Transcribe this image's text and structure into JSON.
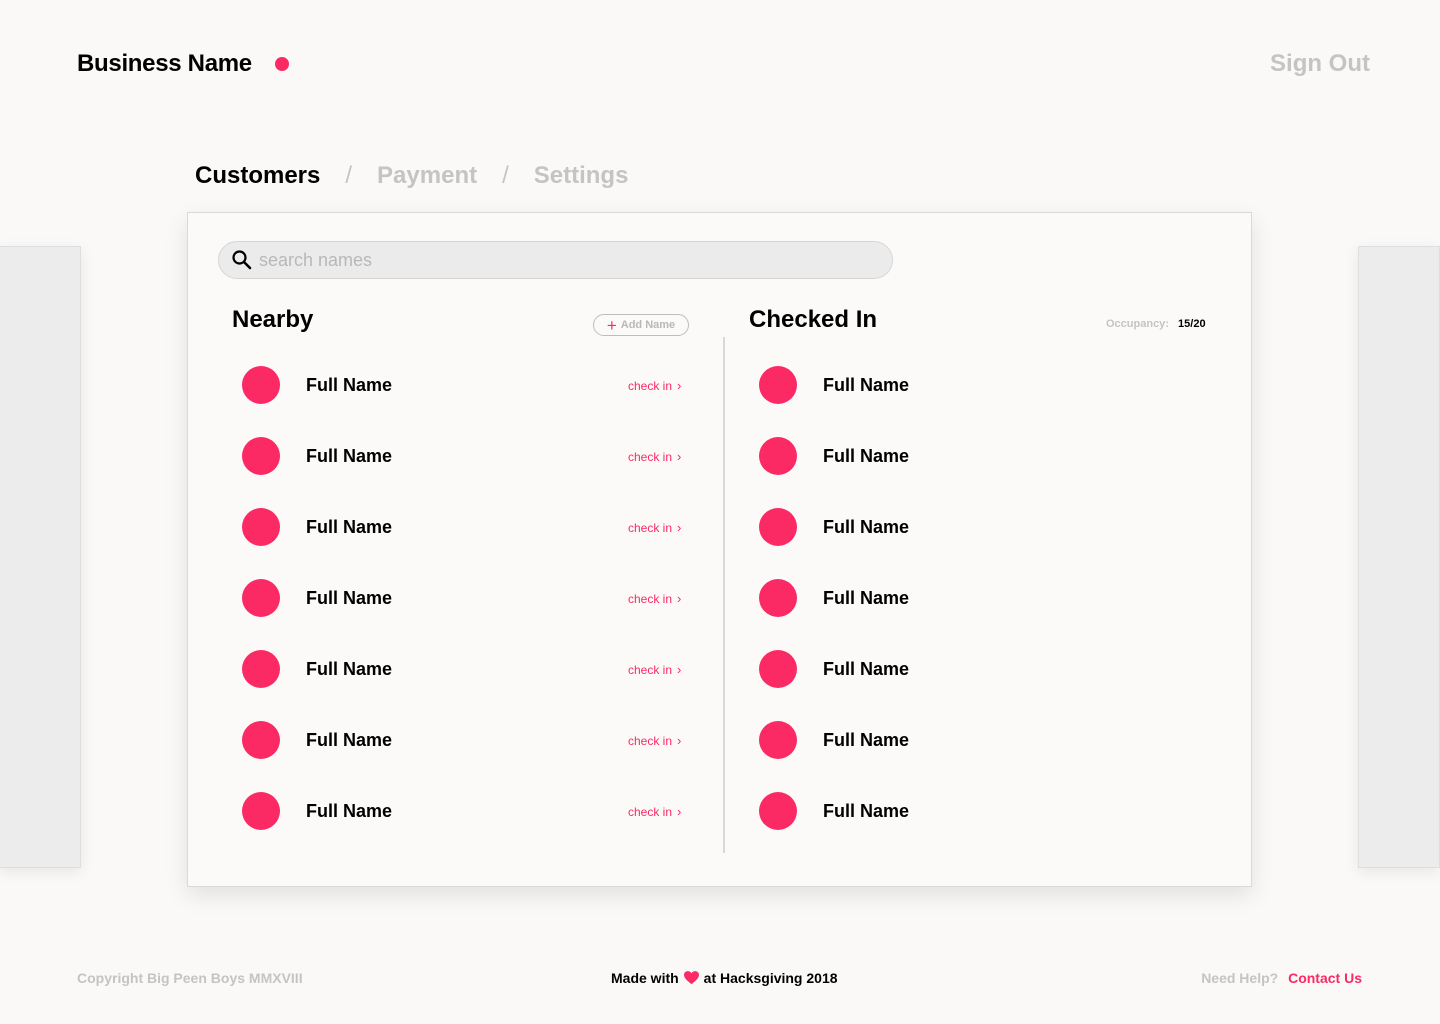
{
  "header": {
    "brand": "Business Name",
    "sign_out": "Sign Out"
  },
  "tabs": [
    {
      "label": "Customers",
      "active": true
    },
    {
      "label": "Payment",
      "active": false
    },
    {
      "label": "Settings",
      "active": false
    }
  ],
  "tab_separator": "/",
  "search": {
    "placeholder": "search names",
    "value": ""
  },
  "nearby": {
    "title": "Nearby",
    "add_name": "Add Name",
    "check_in_label": "check in",
    "items": [
      "Full Name",
      "Full Name",
      "Full Name",
      "Full Name",
      "Full Name",
      "Full Name",
      "Full Name"
    ]
  },
  "checked_in": {
    "title": "Checked In",
    "occupancy_label": "Occupancy:",
    "occupancy_value": "15/20",
    "items": [
      "Full Name",
      "Full Name",
      "Full Name",
      "Full Name",
      "Full Name",
      "Full Name",
      "Full Name"
    ]
  },
  "footer": {
    "copyright": "Copyright Big Peen Boys MMXVIII",
    "made_with": "Made with",
    "made_at": "at Hacksgiving 2018",
    "need_help": "Need Help?",
    "contact": "Contact Us"
  },
  "colors": {
    "accent": "#fb2a64",
    "muted": "#c4c4c4",
    "background": "#faf9f7"
  },
  "icons": {
    "search": "search-icon",
    "add": "plus-icon",
    "chevron": "chevron-right-icon",
    "heart": "heart-icon"
  }
}
